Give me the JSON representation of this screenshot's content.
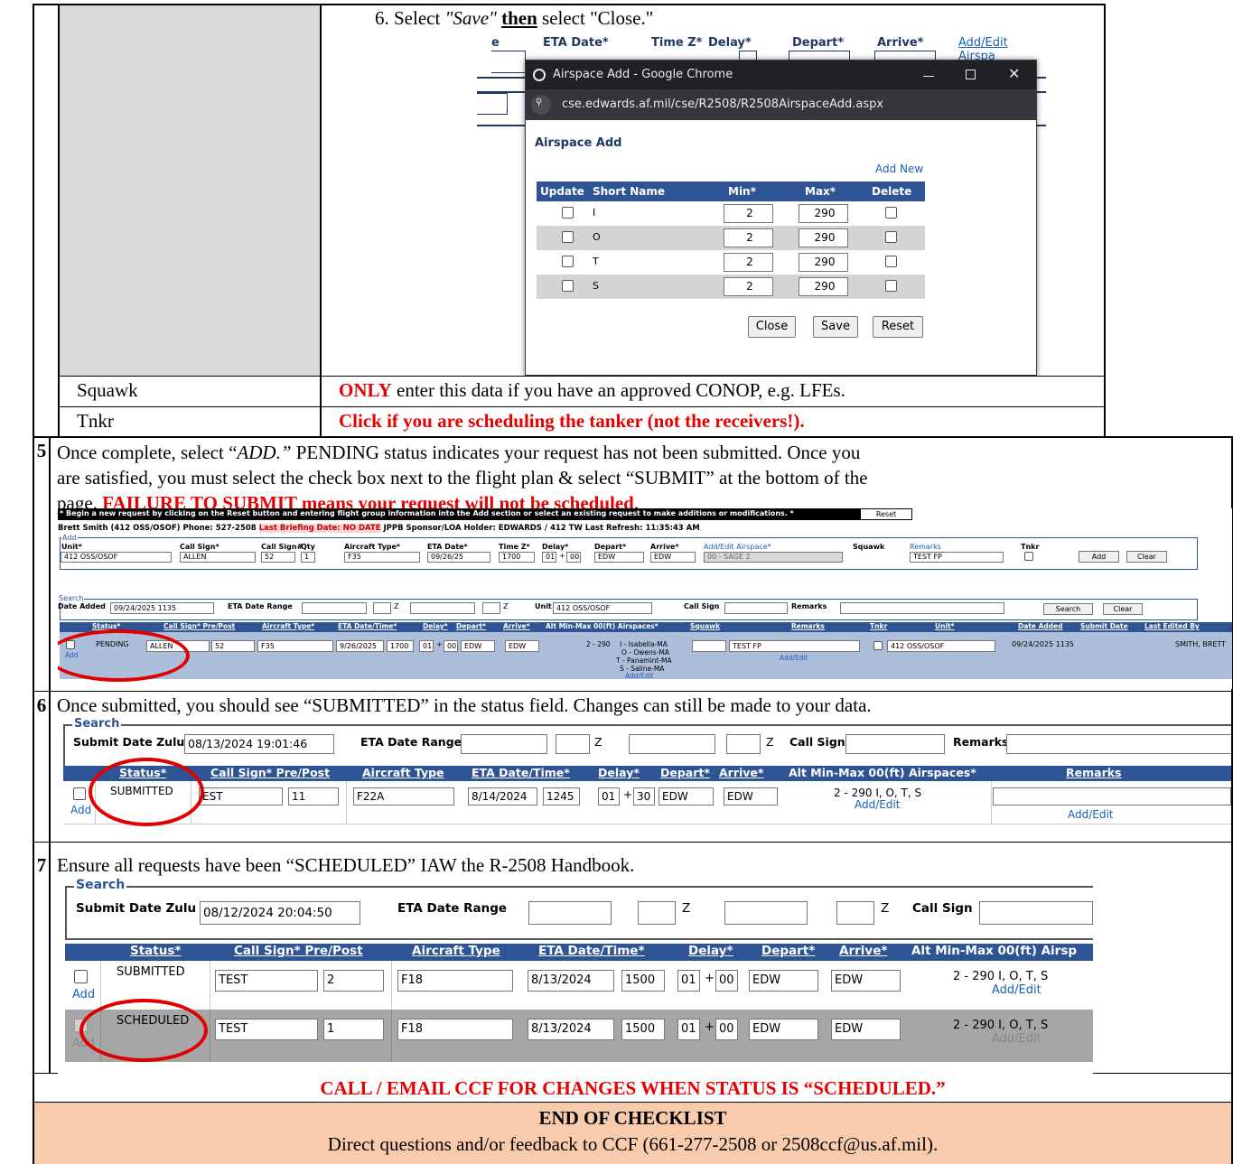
{
  "step_6_instruction": {
    "prefix": "6. Select ",
    "save": "\"Save\"",
    "then": "then",
    "suffix": " select \"Close.\""
  },
  "popup": {
    "bg_labels": [
      "e",
      "ETA Date*",
      "Time Z*",
      "Delay*",
      "Depart*",
      "Arrive*",
      "Add/Edit Airspa"
    ],
    "window_title": "Airspace Add - Google Chrome",
    "url": "cse.edwards.af.mil/cse/R2508/R2508AirspaceAdd.aspx",
    "heading": "Airspace Add",
    "add_new": "Add New",
    "columns": [
      "Update",
      "Short Name",
      "Min*",
      "Max*",
      "Delete"
    ],
    "rows": [
      {
        "name": "I",
        "min": "2",
        "max": "290"
      },
      {
        "name": "O",
        "min": "2",
        "max": "290"
      },
      {
        "name": "T",
        "min": "2",
        "max": "290"
      },
      {
        "name": "S",
        "min": "2",
        "max": "290"
      }
    ],
    "buttons": {
      "close": "Close",
      "save": "Save",
      "reset": "Reset"
    }
  },
  "squawk": {
    "label": "Squawk",
    "only": "ONLY",
    "text": " enter this data if you have an approved CONOP, e.g. LFEs."
  },
  "tnkr": {
    "label": "Tnkr",
    "text": "Click if you are scheduling the tanker (not the receivers!)."
  },
  "step5": {
    "num": "5",
    "line1a": "Once complete, select “",
    "line1b": "ADD.”",
    "line1c": " PENDING status indicates your request has not been submitted.  Once you",
    "line2": "are satisfied, you must select the check box next to the flight plan & select “SUBMIT” at the bottom of the",
    "line3a": "page.  ",
    "line3b": "FAILURE TO SUBMIT means your request will not be scheduled",
    "line3c": "."
  },
  "shot5": {
    "banner": "* Begin a new request by clicking on the Reset button and entering flight group information into the Add section or select an existing request to make additions or modifications. *",
    "reset": "Reset",
    "userline": {
      "a": "Brett Smith (412 OSS/OSOF)   Phone: 527-2508   ",
      "b": "Last Briefing Date: NO DATE",
      "c": "   JPPB Sponsor/LOA Holder: EDWARDS / 412 TW   Last Refresh: 11:35:43 AM"
    },
    "add_legend": "Add",
    "add_labels": [
      "Unit*",
      "Call Sign*",
      "Call Sign#",
      "Qty",
      "Aircraft Type*",
      "ETA Date*",
      "Time Z*",
      "Delay*",
      "Depart*",
      "Arrive*",
      "Add/Edit Airspace*",
      "Squawk",
      "Remarks",
      "Tnkr"
    ],
    "add_values": {
      "unit": "412 OSS/OSOF",
      "callsign": "ALLEN",
      "callnum": "52",
      "qty": "1",
      "aircraft": "F35",
      "eta": "09/26/25",
      "time": "1700",
      "delay1": "01",
      "plus": "+",
      "delay2": "00",
      "depart": "EDW",
      "arrive": "EDW",
      "airspace": "00 - SAGE 2",
      "remarks": "TEST FP"
    },
    "add_button": "Add",
    "clear_button": "Clear",
    "search_legend": "Search",
    "search_labels": {
      "date_added": "Date Added",
      "eta_range": "ETA Date Range",
      "z1": "Z",
      "z2": "Z",
      "unit": "Unit",
      "call_sign": "Call Sign",
      "remarks": "Remarks"
    },
    "search_values": {
      "date_added": "09/24/2025 1135",
      "unit": "412 OSS/OSOF"
    },
    "search_button": "Search",
    "search_clear": "Clear",
    "headers": [
      "Status*",
      "Call Sign* Pre/Post",
      "Aircraft Type*",
      "ETA Date/Time*",
      "Delay*",
      "Depart*",
      "Arrive*",
      "Alt Min-Max 00(ft) Airspaces*",
      "Squawk",
      "Remarks",
      "Tnkr",
      "Unit*",
      "Date Added",
      "Submit Date",
      "Last Edited By"
    ],
    "row": {
      "status": "PENDING",
      "callsign": "ALLEN",
      "num": "52",
      "aircraft": "F35",
      "date": "9/26/2025",
      "time": "1700",
      "d1": "01",
      "plus": "+",
      "d2": "00",
      "depart": "EDW",
      "arrive": "EDW",
      "alt": "2 - 290",
      "airspaces": [
        "I - Isabella-MA",
        "O - Owens-MA",
        "T - Panamint-MA",
        "S - Saline-MA"
      ],
      "addedit": "Add/Edit",
      "remarks": "TEST FP",
      "remarks_addedit": "Add/Edit",
      "unit": "412 OSS/OSOF",
      "date_added": "09/24/2025 1135",
      "edited_by": "SMITH, BRETT",
      "add": "Add"
    }
  },
  "step6": {
    "num": "6",
    "text": "Once submitted, you should see “SUBMITTED” in the status field.  Changes can still be made to your data."
  },
  "shot6": {
    "search": "Search",
    "submit_label": "Submit Date Zulu",
    "submit_value": "08/13/2024 19:01:46",
    "eta_range": "ETA Date Range",
    "z1": "Z",
    "z2": "Z",
    "call_sign": "Call Sign",
    "remarks": "Remarks",
    "headers": [
      "Status*",
      "Call Sign* Pre/Post",
      "Aircraft Type",
      "ETA Date/Time*",
      "Delay*",
      "Depart*",
      "Arrive*",
      "Alt Min-Max 00(ft) Airspaces*",
      "Remarks"
    ],
    "row": {
      "status": "SUBMITTED",
      "callsign": "EST",
      "num": "11",
      "aircraft": "F22A",
      "date": "8/14/2024",
      "time": "1245",
      "d1": "01",
      "plus": "+",
      "d2": "30",
      "depart": "EDW",
      "arrive": "EDW",
      "alt": "2 - 290  I, O, T, S",
      "addedit": "Add/Edit",
      "remarks_addedit": "Add/Edit",
      "add": "Add"
    }
  },
  "step7": {
    "num": "7",
    "text": "Ensure all requests have been “SCHEDULED” IAW the R-2508 Handbook."
  },
  "shot7": {
    "search": "Search",
    "submit_label": "Submit Date Zulu",
    "submit_value": "08/12/2024 20:04:50",
    "eta_range": "ETA Date Range",
    "z1": "Z",
    "z2": "Z",
    "call_sign": "Call Sign",
    "headers": [
      "Status*",
      "Call Sign* Pre/Post",
      "Aircraft Type",
      "ETA Date/Time*",
      "Delay*",
      "Depart*",
      "Arrive*",
      "Alt Min-Max 00(ft) Airsp"
    ],
    "rows": [
      {
        "status": "SUBMITTED",
        "callsign": "TEST",
        "num": "2",
        "aircraft": "F18",
        "date": "8/13/2024",
        "time": "1500",
        "d1": "01",
        "plus": "+",
        "d2": "00",
        "depart": "EDW",
        "arrive": "EDW",
        "alt": "2 - 290  I, O, T, S",
        "addedit": "Add/Edit",
        "add": "Add"
      },
      {
        "status": "SCHEDULED",
        "callsign": "TEST",
        "num": "1",
        "aircraft": "F18",
        "date": "8/13/2024",
        "time": "1500",
        "d1": "01",
        "plus": "+",
        "d2": "00",
        "depart": "EDW",
        "arrive": "EDW",
        "alt": "2 - 290  I, O, T, S",
        "addedit": "Add/Edit",
        "add": "Add"
      }
    ]
  },
  "call_email": "CALL / EMAIL CCF FOR CHANGES WHEN STATUS IS “SCHEDULED.”",
  "end_title": "END OF CHECKLIST",
  "end_text": "Direct questions and/or feedback to CCF (661-277-2508 or 2508ccf@us.af.mil)."
}
